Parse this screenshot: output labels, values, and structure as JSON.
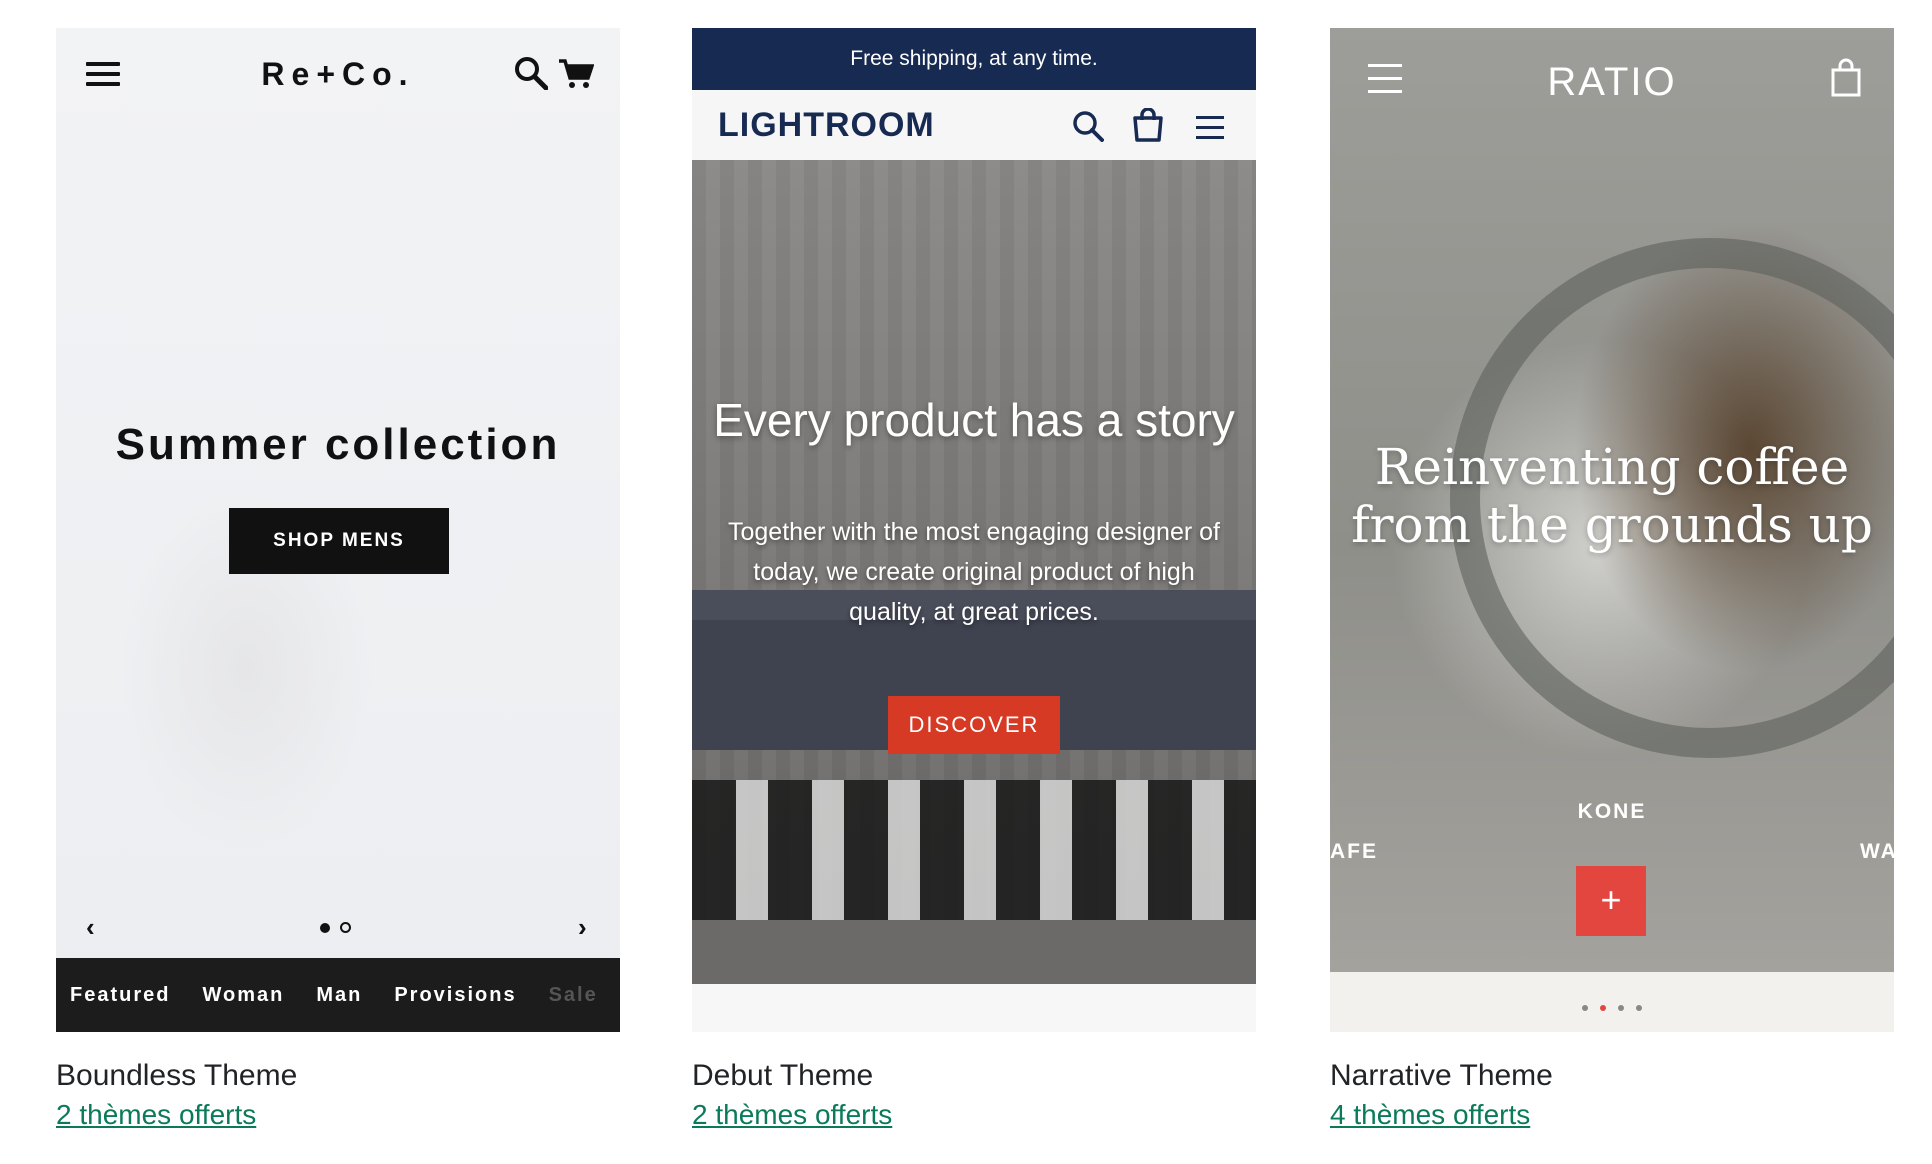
{
  "cards": [
    {
      "theme_name": "Boundless Theme",
      "link_text": "2 thèmes offerts",
      "preview": {
        "logo": "Re+Co.",
        "headline": "Summer collection",
        "cta": "SHOP MENS",
        "prev_icon": "‹",
        "next_icon": "›",
        "slides": 2,
        "active_slide": 1,
        "nav_items": [
          "Featured",
          "Woman",
          "Man",
          "Provisions",
          "Sale"
        ]
      }
    },
    {
      "theme_name": "Debut Theme",
      "link_text": "2 thèmes offerts",
      "preview": {
        "announcement": "Free shipping, at any time.",
        "logo": "LIGHTROOM",
        "headline": "Every product has a story",
        "subtext": "Together with the most engaging designer of today, we create original product of high quality, at great prices.",
        "cta": "DISCOVER"
      }
    },
    {
      "theme_name": "Narrative Theme",
      "link_text": "4 thèmes offerts",
      "preview": {
        "logo": "RATIO",
        "headline": "Reinventing coffee from the grounds up",
        "label_left": "AFE",
        "label_center": "KONE",
        "label_right": "WA",
        "plus": "+",
        "slides": 4,
        "active_slide": 2
      }
    }
  ],
  "colors": {
    "link": "#0b7a5a",
    "debut_navy": "#172a52",
    "debut_red": "#d63a24",
    "narrative_red": "#e2463f",
    "boundless_dark": "#1c1c1c"
  },
  "icons": {
    "boundless": [
      "hamburger-menu-icon",
      "search-icon",
      "cart-icon",
      "chevron-left-icon",
      "chevron-right-icon"
    ],
    "debut": [
      "search-icon",
      "shopping-bag-icon",
      "hamburger-menu-icon"
    ],
    "narrative": [
      "hamburger-menu-icon",
      "shopping-bag-icon"
    ]
  }
}
